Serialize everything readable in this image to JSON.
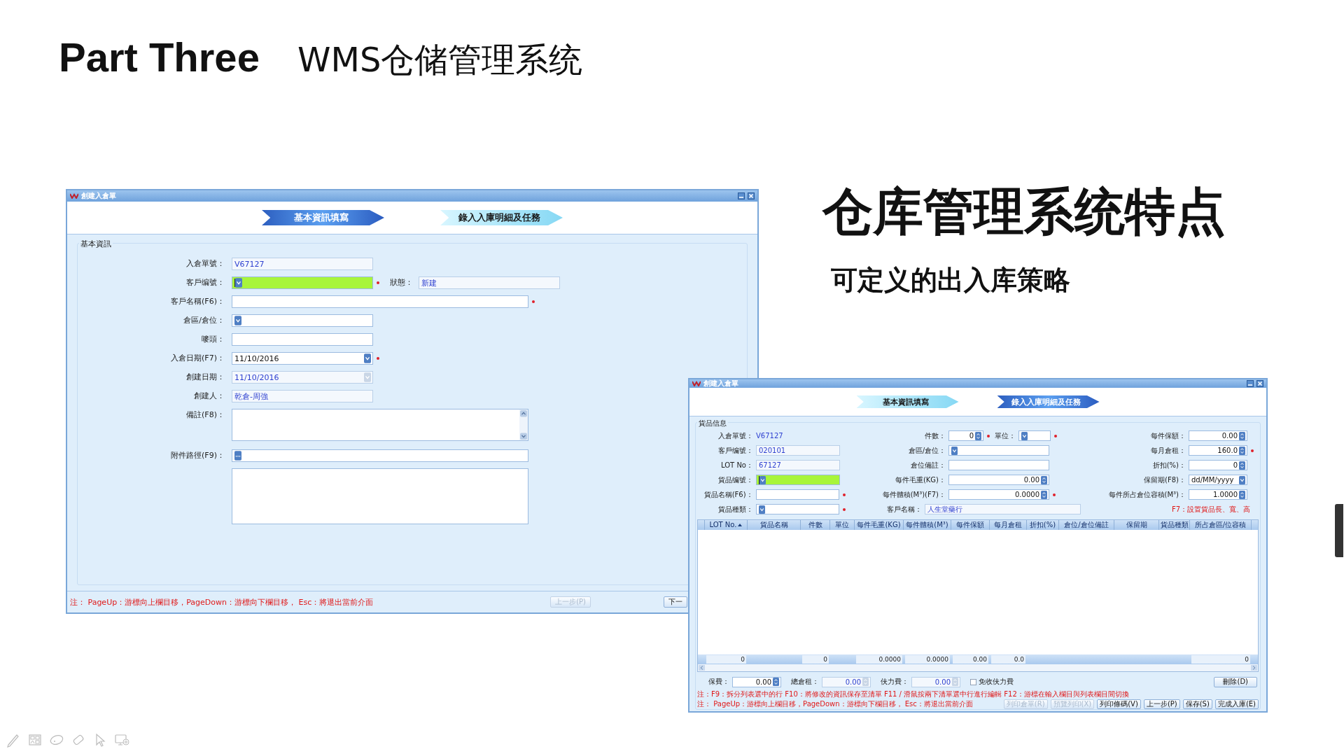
{
  "slide": {
    "title": "Part Three",
    "subtitle": "WMS仓储管理系统",
    "heading": "仓库管理系统特点",
    "subheading": "可定义的出入库策略"
  },
  "window_1": {
    "title": "創建入倉單",
    "steps": [
      {
        "label": "基本資訊填寫",
        "selected": true
      },
      {
        "label": "錄入入庫明細及任務",
        "selected": false
      }
    ],
    "group": "基本資訊",
    "rows": [
      {
        "fields": [
          {
            "label": "入倉單號：",
            "value": "V67127",
            "kind": "text",
            "readonly": true,
            "highlighted": false,
            "required": false
          }
        ]
      },
      {
        "fields": [
          {
            "label": "客戶编號：",
            "kind": "combo",
            "readonly": false,
            "highlighted": true,
            "required": true
          },
          {
            "label": "狀態：",
            "value": "新建",
            "kind": "text",
            "readonly": true,
            "highlighted": false,
            "required": false
          }
        ]
      },
      {
        "fields": [
          {
            "label": "客戶名稱(F6)：",
            "kind": "long",
            "readonly": false,
            "highlighted": false,
            "required": true
          }
        ]
      },
      {
        "fields": [
          {
            "label": "倉區/倉位：",
            "kind": "combo",
            "readonly": false,
            "highlighted": false,
            "required": false
          }
        ]
      },
      {
        "fields": [
          {
            "label": "嘜頭：",
            "kind": "text",
            "readonly": false,
            "highlighted": false,
            "required": false
          }
        ]
      },
      {
        "fields": [
          {
            "label": "入倉日期(F7)：",
            "value": "11/10/2016",
            "kind": "combo",
            "readonly": false,
            "highlighted": false,
            "required": true
          }
        ]
      },
      {
        "fields": [
          {
            "label": "創建日期：",
            "value": "11/10/2016",
            "kind": "combo",
            "readonly": true,
            "highlighted": false,
            "required": false
          }
        ]
      },
      {
        "fields": [
          {
            "label": "創建人：",
            "value": "乾倉-周強",
            "kind": "text",
            "readonly": true,
            "highlighted": false,
            "required": false
          }
        ]
      },
      {
        "fields": [
          {
            "label": "備註(F8)：",
            "kind": "memo",
            "readonly": false,
            "highlighted": false,
            "required": false
          }
        ]
      },
      {
        "fields": [
          {
            "label": "附件路徑(F9)：",
            "kind": "browse",
            "readonly": false,
            "highlighted": false,
            "required": false
          }
        ]
      },
      {
        "fields": [
          {
            "kind": "box",
            "readonly": false,
            "highlighted": false,
            "required": false
          }
        ]
      }
    ],
    "note": "注： PageUp：游標向上欄目移，PageDown：游標向下欄目移， Esc：將退出當前介面",
    "buttons": [
      {
        "label": "上一步(P)",
        "disabled": true
      },
      {
        "label": "下一",
        "disabled": false
      }
    ]
  },
  "window_2": {
    "title": "創建入倉單",
    "steps": [
      {
        "label": "基本資訊填寫",
        "selected": false
      },
      {
        "label": "錄入入庫明細及任務",
        "selected": true
      }
    ],
    "group": "貨品信息",
    "rows": [
      {
        "cells": [
          {
            "fields": [
              {
                "label": "入倉單號：",
                "value": "V67127",
                "kind": "static",
                "readonly": true,
                "highlighted": false,
                "required": false
              }
            ]
          },
          {
            "fields": [
              {
                "label": "件數：",
                "value": "0",
                "kind": "spin",
                "readonly": false,
                "highlighted": false,
                "required": true
              },
              {
                "label": "單位：",
                "kind": "combo",
                "readonly": false,
                "highlighted": false,
                "required": true
              }
            ]
          },
          {
            "fields": [
              {
                "label": "每件保額：",
                "value": "0.00",
                "kind": "spin",
                "readonly": false,
                "highlighted": false,
                "required": false
              }
            ]
          }
        ]
      },
      {
        "cells": [
          {
            "fields": [
              {
                "label": "客戶编號：",
                "value": "020101",
                "kind": "text",
                "readonly": true,
                "highlighted": false,
                "required": false
              }
            ]
          },
          {
            "fields": [
              {
                "label": "倉區/倉位：",
                "kind": "combo",
                "readonly": false,
                "highlighted": false,
                "required": false
              }
            ]
          },
          {
            "fields": [
              {
                "label": "每月倉租：",
                "value": "160.0",
                "kind": "spin",
                "readonly": false,
                "highlighted": false,
                "required": true
              }
            ]
          }
        ]
      },
      {
        "cells": [
          {
            "fields": [
              {
                "label": "LOT No：",
                "value": "67127",
                "kind": "text",
                "readonly": true,
                "highlighted": false,
                "required": false
              }
            ]
          },
          {
            "fields": [
              {
                "label": "倉位備註：",
                "kind": "text",
                "readonly": false,
                "highlighted": false,
                "required": false
              }
            ]
          },
          {
            "fields": [
              {
                "label": "折扣(%)：",
                "value": "0",
                "kind": "spin",
                "readonly": false,
                "highlighted": false,
                "required": false
              }
            ]
          }
        ]
      },
      {
        "cells": [
          {
            "fields": [
              {
                "label": "貨品编號：",
                "kind": "combo",
                "readonly": false,
                "highlighted": true,
                "required": false
              }
            ]
          },
          {
            "fields": [
              {
                "label": "每件毛重(KG)：",
                "value": "0.00",
                "kind": "spin",
                "readonly": false,
                "highlighted": false,
                "required": false
              }
            ]
          },
          {
            "fields": [
              {
                "label": "保留期(F8)：",
                "value": "dd/MM/yyyy",
                "kind": "combo",
                "readonly": false,
                "highlighted": false,
                "required": false
              }
            ]
          }
        ]
      },
      {
        "cells": [
          {
            "fields": [
              {
                "label": "貨品名稱(F6)：",
                "kind": "text",
                "readonly": false,
                "highlighted": false,
                "required": true
              }
            ]
          },
          {
            "fields": [
              {
                "label": "每件體積(M³)(F7)：",
                "value": "0.0000",
                "kind": "spin",
                "readonly": false,
                "highlighted": false,
                "required": true
              }
            ]
          },
          {
            "fields": [
              {
                "label": "每件所占倉位容積(M³)：",
                "value": "1.0000",
                "kind": "spin",
                "readonly": false,
                "highlighted": false,
                "required": false
              }
            ]
          }
        ]
      },
      {
        "cells": [
          {
            "fields": [
              {
                "label": "貨品種類：",
                "kind": "combo",
                "readonly": false,
                "highlighted": false,
                "required": true
              }
            ]
          },
          {
            "fields": [
              {
                "label": "客戶名稱：",
                "value": "人生堂藥行",
                "kind": "wide",
                "readonly": true,
                "highlighted": false,
                "required": false
              }
            ]
          },
          {
            "note": "F7：設置貨品長、寬、高"
          }
        ]
      }
    ],
    "table": {
      "columns": [
        {
          "label": "LOT No.",
          "sorted": true,
          "total": "0"
        },
        {
          "label": "貨品名稱",
          "sorted": false
        },
        {
          "label": "件數",
          "sorted": false,
          "total": "0"
        },
        {
          "label": "單位",
          "sorted": false
        },
        {
          "label": "每件毛重(KG)",
          "sorted": false,
          "total": "0.0000"
        },
        {
          "label": "每件體積(M³)",
          "sorted": false,
          "total": "0.0000"
        },
        {
          "label": "每件保額",
          "sorted": false,
          "total": "0.00"
        },
        {
          "label": "每月倉租",
          "sorted": false,
          "total": "0.0"
        },
        {
          "label": "折扣(%)",
          "sorted": false
        },
        {
          "label": "倉位/倉位備註",
          "sorted": false
        },
        {
          "label": "保留期",
          "sorted": false
        },
        {
          "label": "貨品種類",
          "sorted": false
        },
        {
          "label": "所占倉區/位容積",
          "sorted": false,
          "total": "0"
        }
      ]
    },
    "summary": [
      {
        "label": "保費：",
        "value": "0.00",
        "readonly": false
      },
      {
        "label": "總倉租：",
        "value": "0.00",
        "readonly": true
      },
      {
        "label": "伕力費：",
        "value": "0.00",
        "readonly": true
      }
    ],
    "checkbox": {
      "label": "免收伕力費",
      "checked": false
    },
    "delete_button": "刪除(D)",
    "notes": [
      "注：F9：拆分列表選中的行   F10：將修改的資訊保存至清單   F11 / 滑鼠按兩下清單選中行進行編輯     F12：游標在輸入欄目與列表欄目間切換",
      "注： PageUp：游標向上欄目移，PageDown：游標向下欄目移， Esc：將退出當前介面"
    ],
    "buttons": [
      {
        "label": "列印倉單(R)",
        "disabled": true
      },
      {
        "label": "預覽列印(X)",
        "disabled": true
      },
      {
        "label": "列印條碼(V)",
        "disabled": false
      },
      {
        "label": "上一步(P)",
        "disabled": false
      },
      {
        "label": "保存(S)",
        "disabled": false
      },
      {
        "label": "完成入庫(E)",
        "disabled": false
      }
    ]
  }
}
